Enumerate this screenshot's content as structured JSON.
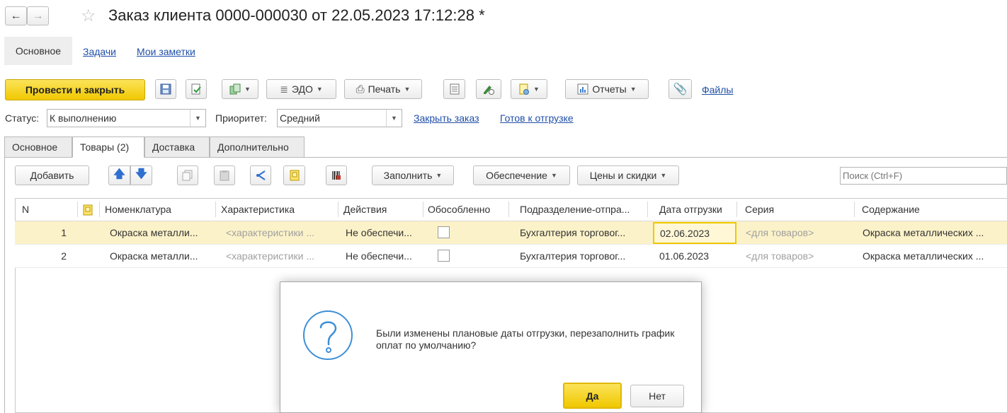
{
  "window": {
    "title": "Заказ клиента 0000-000030 от 22.05.2023 17:12:28 *"
  },
  "top_tabs": [
    {
      "label": "Основное"
    },
    {
      "label": "Задачи"
    },
    {
      "label": "Мои заметки"
    }
  ],
  "toolbar": {
    "post_close_label": "Провести и закрыть",
    "edo_label": "ЭДО",
    "print_label": "Печать",
    "reports_label": "Отчеты",
    "files_label": "Файлы"
  },
  "status_bar": {
    "status_label": "Статус:",
    "status_value": "К выполнению",
    "priority_label": "Приоритет:",
    "priority_value": "Средний",
    "close_order_link": "Закрыть заказ",
    "ready_link": "Готов к отгрузке"
  },
  "doc_tabs": [
    {
      "label": "Основное"
    },
    {
      "label": "Товары (2)"
    },
    {
      "label": "Доставка"
    },
    {
      "label": "Дополнительно"
    }
  ],
  "table_toolbar": {
    "add_label": "Добавить",
    "fill_label": "Заполнить",
    "supply_label": "Обеспечение",
    "prices_label": "Цены и скидки",
    "search_placeholder": "Поиск (Ctrl+F)"
  },
  "table": {
    "columns": [
      "N",
      "",
      "Номенклатура",
      "Характеристика",
      "Действия",
      "Обособленно",
      "Подразделение-отпра...",
      "Дата отгрузки",
      "Серия",
      "Содержание"
    ],
    "rows": [
      {
        "n": "1",
        "item": "Окраска металли...",
        "characteristic": "<характеристики ...",
        "action": "Не обеспечи...",
        "separately": false,
        "department": "Бухгалтерия торговог...",
        "ship_date": "02.06.2023",
        "series": "<для товаров>",
        "content": "Окраска металлических ..."
      },
      {
        "n": "2",
        "item": "Окраска металли...",
        "characteristic": "<характеристики ...",
        "action": "Не обеспечи...",
        "separately": false,
        "department": "Бухгалтерия торговог...",
        "ship_date": "01.06.2023",
        "series": "<для товаров>",
        "content": "Окраска металлических ..."
      }
    ]
  },
  "dialog": {
    "message": "Были изменены плановые даты отгрузки, перезаполнить график оплат по умолчанию?",
    "yes_label": "Да",
    "no_label": "Нет"
  },
  "colors": {
    "primary_button": "#f5d224",
    "selected_row": "#fcf2c9",
    "link": "#1f4fa8",
    "question_icon": "#3f8fd6"
  }
}
